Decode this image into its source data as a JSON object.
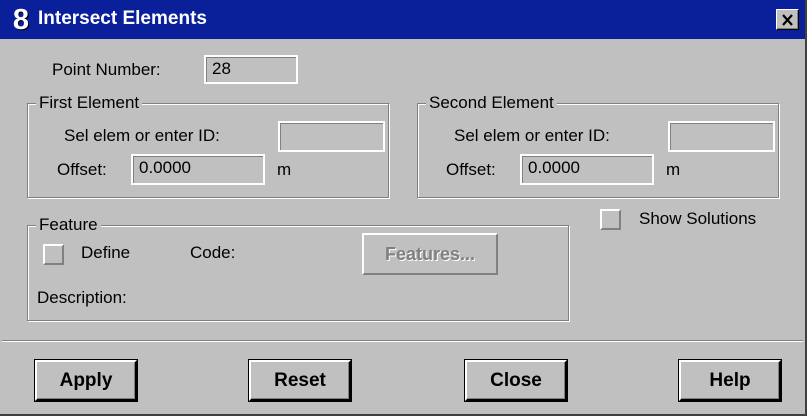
{
  "window": {
    "title": "Intersect Elements",
    "app_icon_glyph": "8",
    "close_glyph": "✕"
  },
  "point": {
    "label": "Point Number:",
    "value": "28"
  },
  "first_element": {
    "group_label": "First Element",
    "sel_label": "Sel elem or enter ID:",
    "sel_value": "",
    "offset_label": "Offset:",
    "offset_value": "0.0000",
    "unit": "m"
  },
  "second_element": {
    "group_label": "Second Element",
    "sel_label": "Sel elem or enter ID:",
    "sel_value": "",
    "offset_label": "Offset:",
    "offset_value": "0.0000",
    "unit": "m"
  },
  "show_solutions": {
    "label": "Show Solutions",
    "checked": false
  },
  "feature": {
    "group_label": "Feature",
    "define_label": "Define",
    "define_checked": false,
    "code_label": "Code:",
    "features_button": "Features...",
    "description_label": "Description:"
  },
  "buttons": {
    "apply": "Apply",
    "reset": "Reset",
    "close": "Close",
    "help": "Help"
  },
  "colors": {
    "titlebar": "#0a1f9a",
    "face": "#c0c0c0"
  }
}
